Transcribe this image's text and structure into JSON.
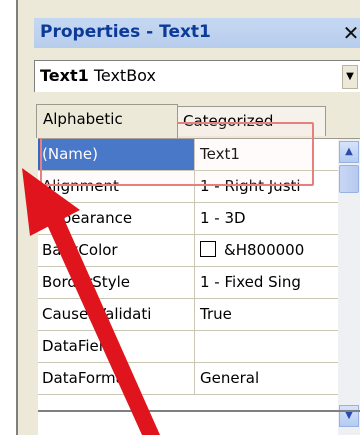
{
  "window": {
    "title": "Properties - Text1",
    "close_glyph": "✕"
  },
  "object_selector": {
    "name": "Text1",
    "type": "TextBox"
  },
  "tabs": [
    {
      "label": "Alphabetic",
      "active": true
    },
    {
      "label": "Categorized",
      "active": false
    }
  ],
  "properties": [
    {
      "name": "(Name)",
      "value": "Text1",
      "selected": true
    },
    {
      "name": "Alignment",
      "value": "1 - Right Justi",
      "selected": false
    },
    {
      "name": "Appearance",
      "value": "1 - 3D",
      "selected": false
    },
    {
      "name": "BackColor",
      "value": "&H800000",
      "selected": false
    },
    {
      "name": "BorderStyle",
      "value": "1 - Fixed Sing",
      "selected": false
    },
    {
      "name": "CausesValidati",
      "value": "True",
      "selected": false
    },
    {
      "name": "DataField",
      "value": "",
      "selected": false
    },
    {
      "name": "DataFormat",
      "value": "General",
      "selected": false
    }
  ],
  "annotation": {
    "highlight_color": "#e87f7f",
    "arrow_color": "#e0141c"
  },
  "colors": {
    "selection": "#316ac5",
    "title_text": "#0b3a98"
  }
}
